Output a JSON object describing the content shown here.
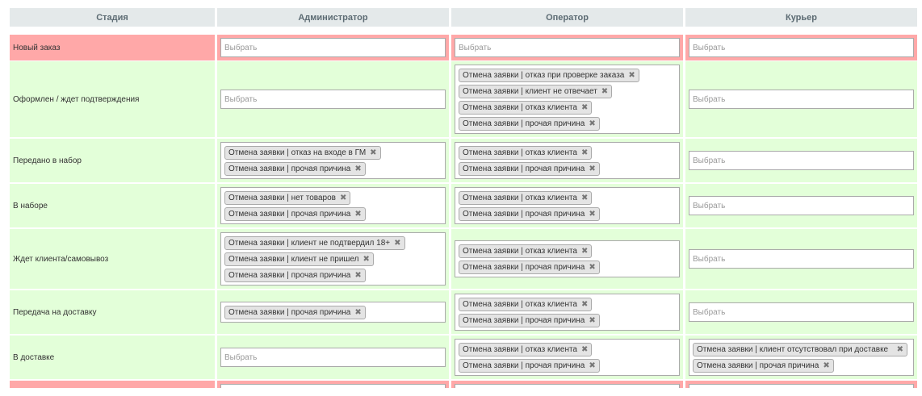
{
  "headers": [
    "Стадия",
    "Администратор",
    "Оператор",
    "Курьер"
  ],
  "placeholder": "Выбрать",
  "remove_glyph": "✖",
  "rows": [
    {
      "stage": "Новый заказ",
      "color": "red",
      "admin": [],
      "operator": [],
      "courier": []
    },
    {
      "stage": "Оформлен / ждет подтверждения",
      "color": "green",
      "admin": [],
      "operator": [
        "Отмена заявки | отказ при проверке заказа",
        "Отмена заявки | клиент не отвечает",
        "Отмена заявки | отказ клиента",
        "Отмена заявки | прочая причина"
      ],
      "courier": []
    },
    {
      "stage": "Передано в набор",
      "color": "green",
      "admin": [
        "Отмена заявки | отказ на входе в ГМ",
        "Отмена заявки | прочая причина"
      ],
      "operator": [
        "Отмена заявки | отказ клиента",
        "Отмена заявки | прочая причина"
      ],
      "courier": []
    },
    {
      "stage": "В наборе",
      "color": "green",
      "admin": [
        "Отмена заявки | нет товаров",
        "Отмена заявки | прочая причина"
      ],
      "operator": [
        "Отмена заявки | отказ клиента",
        "Отмена заявки | прочая причина"
      ],
      "courier": []
    },
    {
      "stage": "Ждет клиента/самовывоз",
      "color": "green",
      "admin": [
        "Отмена заявки | клиент не подтвердил 18+",
        "Отмена заявки | клиент не пришел",
        "Отмена заявки | прочая причина"
      ],
      "operator": [
        "Отмена заявки | отказ клиента",
        "Отмена заявки | прочая причина"
      ],
      "courier": []
    },
    {
      "stage": "Передача на доставку",
      "color": "green",
      "admin": [
        "Отмена заявки | прочая причина"
      ],
      "operator": [
        "Отмена заявки | отказ клиента",
        "Отмена заявки | прочая причина"
      ],
      "courier": []
    },
    {
      "stage": "В доставке",
      "color": "green",
      "admin": [],
      "operator": [
        "Отмена заявки | отказ клиента",
        "Отмена заявки | прочая причина"
      ],
      "courier": [
        "Отмена заявки | клиент отсутствовал при доставке",
        "Отмена заявки | прочая причина"
      ]
    }
  ]
}
